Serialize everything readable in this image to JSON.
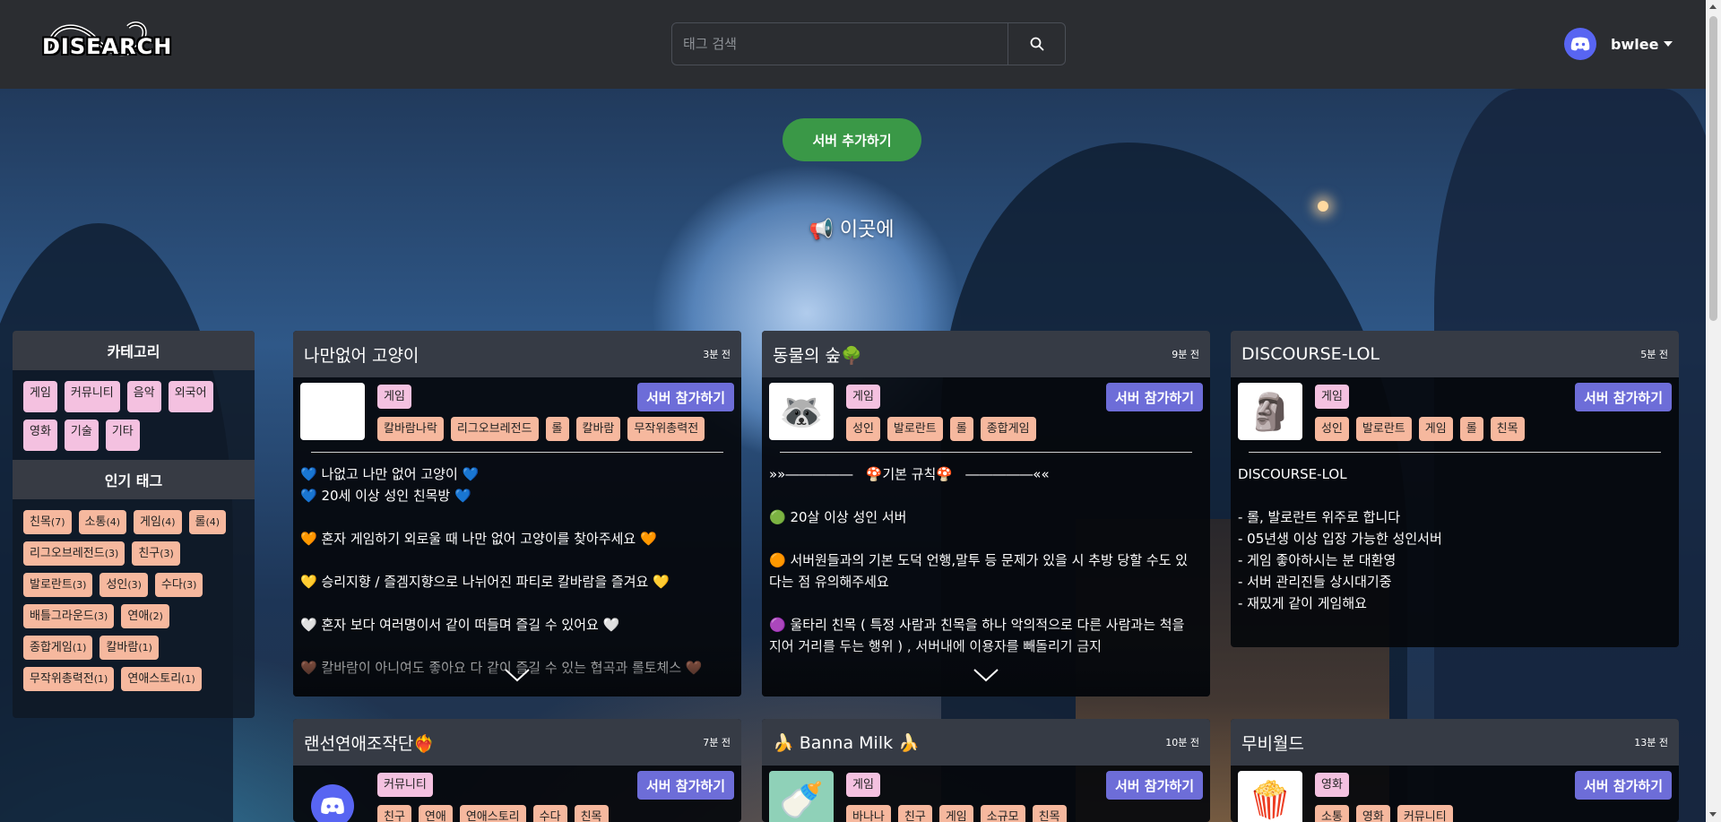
{
  "header": {
    "logo_text": "DISEARCH",
    "search_placeholder": "태그 검색",
    "username": "bwlee"
  },
  "hero": {
    "add_server_label": "서버 추가하기",
    "banner_text": "📢 이곳에"
  },
  "sidebar": {
    "category_title": "카테고리",
    "categories": [
      "게임",
      "커뮤니티",
      "음악",
      "외국어",
      "영화",
      "기술",
      "기타"
    ],
    "popular_title": "인기 태그",
    "popular_tags": [
      {
        "name": "친목",
        "count": "(7)"
      },
      {
        "name": "소통",
        "count": "(4)"
      },
      {
        "name": "게임",
        "count": "(4)"
      },
      {
        "name": "롤",
        "count": "(4)"
      },
      {
        "name": "리그오브레전드",
        "count": "(3)"
      },
      {
        "name": "친구",
        "count": "(3)"
      },
      {
        "name": "발로란트",
        "count": "(3)"
      },
      {
        "name": "성인",
        "count": "(3)"
      },
      {
        "name": "수다",
        "count": "(3)"
      },
      {
        "name": "배틀그라운드",
        "count": "(3)"
      },
      {
        "name": "연애",
        "count": "(2)"
      },
      {
        "name": "종합게임",
        "count": "(1)"
      },
      {
        "name": "칼바람",
        "count": "(1)"
      },
      {
        "name": "무작위총력전",
        "count": "(1)"
      },
      {
        "name": "연애스토리",
        "count": "(1)"
      }
    ]
  },
  "join_label": "서버 참가하기",
  "cards": [
    {
      "title": "나만없어 고양이",
      "time": "3분 전",
      "category": "게임",
      "thumb": "🐱",
      "tags": [
        "칼바람나락",
        "리그오브레전드",
        "롤",
        "칼바람",
        "무작위총력전"
      ],
      "desc": "💙 나없고 나만 없어 고양이 💙\n💙 20세 이상 성인 친목방 💙\n\n🧡 혼자 게임하기 외로울 때 나만 없어 고양이를 찾아주세요 🧡\n\n💛 승리지향 / 즐겜지향으로 나뉘어진 파티로 칼바람을 즐겨요 💛\n\n🤍 혼자 보다 여러명이서 같이 떠들며 즐길 수 있어요 🤍\n\n🤎 칼바람이 아니여도 좋아요 다 같이 즐길 수 있는 협곡과 롤토체스 🤎"
    },
    {
      "title": "동물의 숲🌳",
      "time": "9분 전",
      "category": "게임",
      "thumb": "🦝",
      "tags": [
        "성인",
        "발로란트",
        "롤",
        "종합게임"
      ],
      "desc": "»»―――――   🍄기본 규칙🍄   ―――――««\n\n🟢 20살 이상 성인 서버\n\n🟠 서버원들과의 기본 도덕 언행,말투 등 문제가 있을 시 추방 당할 수도 있다는 점 유의해주세요\n\n🟣 울타리 친목 ( 특정 사람과 친목을 하나 악의적으로 다른 사람과는 척을 지어 거리를 두는 행위 ) , 서버내에 이용자를 빼돌리기 금지"
    },
    {
      "title": "DISCOURSE-LOL",
      "time": "5분 전",
      "category": "게임",
      "thumb": "🗿",
      "tags": [
        "성인",
        "발로란트",
        "게임",
        "롤",
        "친목"
      ],
      "desc": "DISCOURSE-LOL\n\n- 롤, 발로란트 위주로 합니다\n- 05년생 이상 입장 가능한 성인서버\n- 게임 좋아하시는 분 대환영\n- 서버 관리진들 상시대기중\n- 재밌게 같이 게임해요"
    },
    {
      "title": "랜선연애조작단❤️‍🔥",
      "time": "7분 전",
      "category": "커뮤니티",
      "thumb": "discord",
      "tags": [
        "친구",
        "연애",
        "연애스토리",
        "수다",
        "친목"
      ],
      "desc": ""
    },
    {
      "title": "🍌 Banna Milk 🍌",
      "time": "10분 전",
      "category": "게임",
      "thumb": "🍼",
      "tags": [
        "바나나",
        "친구",
        "게임",
        "소규모",
        "친목"
      ],
      "desc": ""
    },
    {
      "title": "무비월드",
      "time": "13분 전",
      "category": "영화",
      "thumb": "🍿",
      "tags": [
        "소통",
        "영화",
        "커뮤니티"
      ],
      "desc": ""
    }
  ]
}
